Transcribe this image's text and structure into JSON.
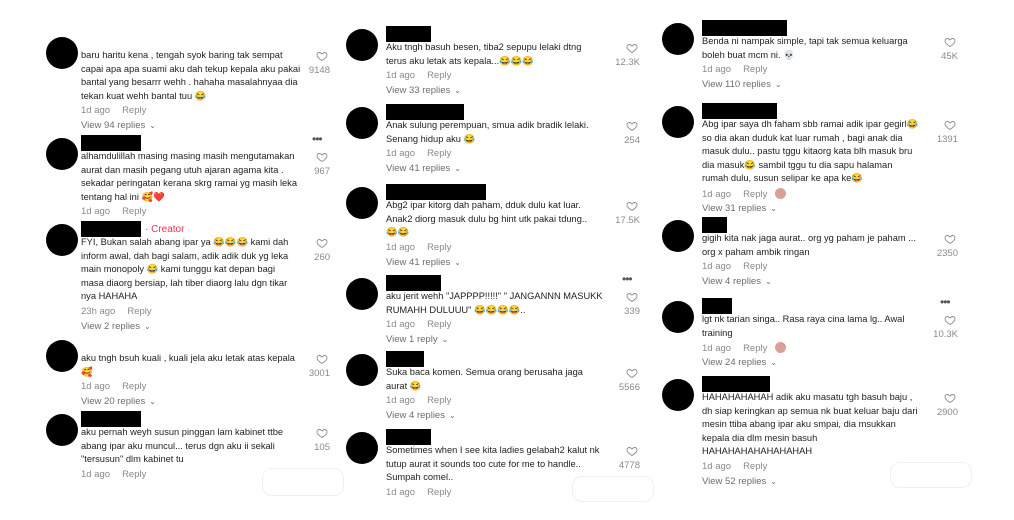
{
  "col1": [
    {
      "lines": [
        "baru haritu kena , tengah syok baring tak sempat",
        "capai apa apa suami aku dah tekup kepala aku pakai",
        "bantal yang besarrr wehh . hahaha masalahnyaa dia",
        "tekan kuat wehh bantal tuu 😂"
      ],
      "time": "1d ago",
      "reply": "Reply",
      "replies": "View 94 replies",
      "likes": "9148"
    },
    {
      "lines": [
        "alhamdulillah masing masing masih mengutamakan",
        "aurat dan masih pegang utuh ajaran agama kita .",
        "sekadar peringatan kerana skrg ramai yg masih leka",
        "tentang hal ini 🥰❤️"
      ],
      "time": "1d ago",
      "reply": "Reply",
      "replies": "",
      "likes": "967"
    },
    {
      "creator": "· Creator",
      "lines": [
        "FYI, Bukan salah abang ipar ya 😂😂😂 kami dah",
        "inform awal, dah bagi salam, adik adik duk yg leka",
        "main monopoly 😂 kami tunggu kat depan bagi",
        "masa diaorg bersiap, lah tiber diaorg lalu dgn tikar",
        "nya HAHAHA"
      ],
      "time": "23h ago",
      "reply": "Reply",
      "replies": "View 2 replies",
      "likes": "260"
    },
    {
      "lines": [
        "aku tngh bsuh kuali , kuali jela aku letak atas kepala",
        "🥰"
      ],
      "time": "1d ago",
      "reply": "Reply",
      "replies": "View 20 replies",
      "likes": "3001"
    },
    {
      "lines": [
        "aku pernah weyh susun pinggan lam kabinet ttbe",
        "abang ipar aku muncul... terus dgn aku ii sekali",
        "\"tersusun\" dlm kabinet tu"
      ],
      "time": "1d ago",
      "reply": "Reply",
      "replies": "",
      "likes": "105"
    }
  ],
  "col2": [
    {
      "lines": [
        "Aku tngh basuh besen, tiba2 sepupu lelaki dtng",
        "terus aku letak ats kepala...😂😂😂"
      ],
      "time": "1d ago",
      "reply": "Reply",
      "replies": "View 33 replies",
      "likes": "12.3K"
    },
    {
      "lines": [
        "Anak sulung perempuan, smua adik bradik lelaki.",
        "Senang hidup aku 😂"
      ],
      "time": "1d ago",
      "reply": "Reply",
      "replies": "View 41 replies",
      "likes": "254"
    },
    {
      "lines": [
        "Abg2 ipar kitorg dah paham, dduk dulu kat luar.",
        "Anak2 diorg masuk dulu bg hint utk pakai tdung..",
        "😂😂"
      ],
      "time": "1d ago",
      "reply": "Reply",
      "replies": "View 41 replies",
      "likes": "17.5K"
    },
    {
      "lines": [
        "aku jerit wehh \"JAPPPP!!!!!\" \" JANGANNN MASUKK",
        "RUMAHH DULUUU\" 😂😂😂😂.."
      ],
      "time": "1d ago",
      "reply": "Reply",
      "replies": "View 1 reply",
      "likes": "339"
    },
    {
      "lines": [
        "Suka baca komen. Semua orang berusaha jaga",
        "aurat 😂"
      ],
      "time": "1d ago",
      "reply": "Reply",
      "replies": "View 4 replies",
      "likes": "5566"
    },
    {
      "lines": [
        "Sometimes when I see kita ladies gelabah2 kalut nk",
        "tutup aurat it sounds too cute for me to handle..",
        "Sumpah comel.."
      ],
      "time": "1d ago",
      "reply": "Reply",
      "replies": "",
      "likes": "4778"
    }
  ],
  "col3": [
    {
      "lines": [
        "Benda ni nampak simple, tapi tak semua keluarga",
        "boleh buat mcm ni. 💀"
      ],
      "time": "1d ago",
      "reply": "Reply",
      "replies": "View 110 replies",
      "likes": "45K"
    },
    {
      "lines": [
        "Abg ipar saya dh faham sbb ramai adik ipar gegirl😂",
        "so dia akan duduk kat luar rumah , bagi anak dia",
        "masuk dulu.. pastu tggu kitaorg kata blh masuk bru",
        "dia masuk😂 sambil tggu tu dia sapu halaman",
        "rumah dulu, susun selipar ke apa ke😂"
      ],
      "time": "1d ago",
      "reply": "Reply",
      "replies": "View 31 replies",
      "likes": "1391"
    },
    {
      "lines": [
        "gigih kita nak jaga aurat.. org yg paham je paham ...",
        "org x paham ambik ringan"
      ],
      "time": "1d ago",
      "reply": "Reply",
      "replies": "View 4 replies",
      "likes": "2350"
    },
    {
      "lines": [
        "lgt nk tarian singa.. Rasa raya cina lama lg.. Awal",
        "training"
      ],
      "time": "1d ago",
      "reply": "Reply",
      "replies": "View 24 replies",
      "likes": "10.3K"
    },
    {
      "lines": [
        "HAHAHAHAHAH adik aku masatu tgh basuh baju ,",
        "dh siap keringkan ap semua nk buat keluar baju dari",
        "mesin ttiba abang ipar aku smpai, dia msukkan",
        "kepala dia dlm mesin basuh",
        "HAHAHAHAHAHAHAHAH"
      ],
      "time": "1d ago",
      "reply": "Reply",
      "replies": "View 52 replies",
      "likes": "2900"
    }
  ]
}
